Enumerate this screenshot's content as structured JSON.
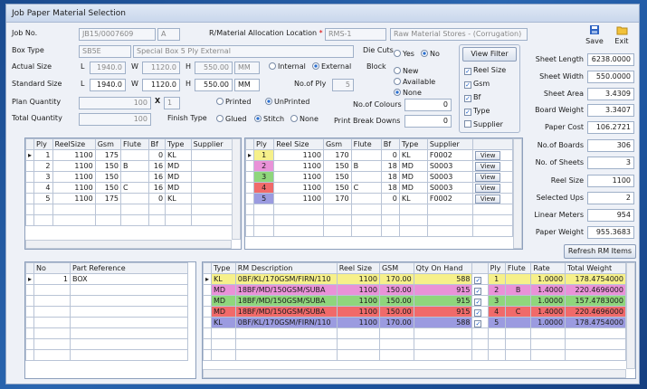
{
  "window": {
    "title": "Job Paper Material Selection",
    "save": "Save",
    "exit": "Exit"
  },
  "job": {
    "job_no_label": "Job No.",
    "job_no": "JB15/0007609",
    "job_suffix": "A",
    "alloc_label": "R/Material Allocation Location",
    "alloc_code": "RMS-1",
    "alloc_name": "Raw Material Stores - (Corrugation)"
  },
  "box": {
    "label": "Box Type",
    "code": "SB5E",
    "desc": "Special Box 5 Ply External"
  },
  "actual": {
    "label": "Actual Size",
    "l": "L",
    "lv": "1940.0",
    "w": "W",
    "wv": "1120.0",
    "h": "H",
    "hv": "550.00",
    "unit": "MM"
  },
  "standard": {
    "label": "Standard Size",
    "l": "L",
    "lv": "1940.0",
    "w": "W",
    "wv": "1120.0",
    "h": "H",
    "hv": "550.00",
    "unit": "MM"
  },
  "dims": {
    "internal": "Internal",
    "external": "External"
  },
  "plan": {
    "label": "Plan Quantity",
    "value": "100",
    "x": "X",
    "xv": "1"
  },
  "total": {
    "label": "Total Quantity",
    "value": "100"
  },
  "ply": {
    "label": "No.of Ply",
    "value": "5"
  },
  "dies": {
    "label": "Die Cuts",
    "yes": "Yes",
    "no": "No"
  },
  "block": {
    "label": "Block",
    "new": "New",
    "available": "Available",
    "none": "None"
  },
  "print": {
    "printed": "Printed",
    "unprinted": "UnPrinted",
    "colours_label": "No.of Colours",
    "colours": "0",
    "breaks_label": "Print Break Downs",
    "breaks": "0"
  },
  "finish": {
    "label": "Finish Type",
    "glued": "Glued",
    "stitch": "Stitch",
    "none": "None"
  },
  "filter": {
    "label": "View Filter",
    "reel": "Reel Size",
    "gsm": "Gsm",
    "bf": "Bf",
    "type": "Type",
    "supplier": "Supplier"
  },
  "summary": [
    {
      "label": "Sheet Length",
      "value": "6238.0000"
    },
    {
      "label": "Sheet Width",
      "value": "550.0000"
    },
    {
      "label": "Sheet Area",
      "value": "3.4309"
    },
    {
      "label": "Board Weight",
      "value": "3.3407"
    },
    {
      "label": "Paper Cost",
      "value": "106.2721"
    },
    {
      "label": "No.of Boards",
      "value": "306"
    },
    {
      "label": "No. of Sheets",
      "value": "3"
    },
    {
      "label": "Reel Size",
      "value": "1100"
    },
    {
      "label": "Selected Ups",
      "value": "2"
    },
    {
      "label": "Linear Meters",
      "value": "954"
    },
    {
      "label": "Paper Weight",
      "value": "955.3683"
    }
  ],
  "refresh": "Refresh RM Items",
  "gridA": {
    "headers": [
      "Ply",
      "ReelSize",
      "Gsm",
      "Flute",
      "Bf",
      "Type",
      "Supplier"
    ],
    "rows": [
      [
        "1",
        "1100",
        "175",
        "",
        "0",
        "KL",
        ""
      ],
      [
        "2",
        "1100",
        "150",
        "B",
        "16",
        "MD",
        ""
      ],
      [
        "3",
        "1100",
        "150",
        "",
        "16",
        "MD",
        ""
      ],
      [
        "4",
        "1100",
        "150",
        "C",
        "16",
        "MD",
        ""
      ],
      [
        "5",
        "1100",
        "175",
        "",
        "0",
        "KL",
        ""
      ]
    ]
  },
  "gridB": {
    "headers": [
      "Ply",
      "Reel Size",
      "Gsm",
      "Flute",
      "Bf",
      "Type",
      "Supplier",
      ""
    ],
    "view": "View",
    "rows": [
      [
        "1",
        "1100",
        "170",
        "",
        "0",
        "KL",
        "F0002"
      ],
      [
        "2",
        "1100",
        "150",
        "B",
        "18",
        "MD",
        "S0003"
      ],
      [
        "3",
        "1100",
        "150",
        "",
        "18",
        "MD",
        "S0003"
      ],
      [
        "4",
        "1100",
        "150",
        "C",
        "18",
        "MD",
        "S0003"
      ],
      [
        "5",
        "1100",
        "170",
        "",
        "0",
        "KL",
        "F0002"
      ]
    ]
  },
  "gridC": {
    "headers": [
      "No",
      "Part Reference"
    ],
    "rows": [
      [
        "1",
        "BOX"
      ]
    ]
  },
  "gridD": {
    "headers": [
      "Type",
      "RM Description",
      "Reel Size",
      "GSM",
      "Qty On Hand",
      "",
      "Ply",
      "Flute",
      "Rate",
      "Total Weight"
    ],
    "rows": [
      [
        "KL",
        "0BF/KL/170GSM/FIRN/110",
        "1100",
        "170.00",
        "588",
        "1",
        "",
        "1.0000",
        "178.4754000"
      ],
      [
        "MD",
        "18BF/MD/150GSM/SUBA",
        "1100",
        "150.00",
        "915",
        "2",
        "B",
        "1.4000",
        "220.4696000"
      ],
      [
        "MD",
        "18BF/MD/150GSM/SUBA",
        "1100",
        "150.00",
        "915",
        "3",
        "",
        "1.0000",
        "157.4783000"
      ],
      [
        "MD",
        "18BF/MD/150GSM/SUBA",
        "1100",
        "150.00",
        "915",
        "4",
        "C",
        "1.4000",
        "220.4696000"
      ],
      [
        "KL",
        "0BF/KL/170GSM/FIRN/110",
        "1100",
        "170.00",
        "588",
        "5",
        "",
        "1.0000",
        "178.4754000"
      ]
    ]
  },
  "colors": {
    "row1": "#f6f08a",
    "row2": "#e992d8",
    "row3": "#8fd67c",
    "row4": "#f06a6a",
    "row5": "#9b9be0"
  }
}
